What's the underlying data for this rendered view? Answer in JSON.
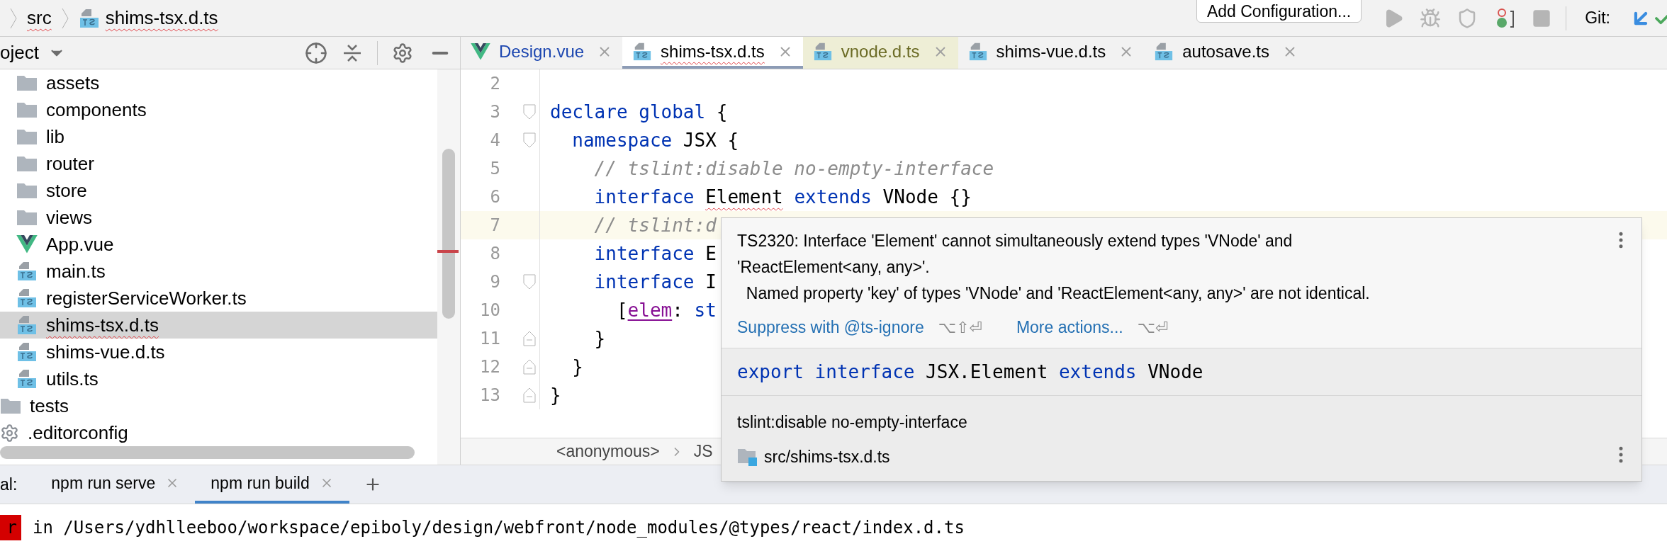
{
  "breadcrumb": [
    {
      "label": "src",
      "kind": "folder",
      "error": true
    },
    {
      "label": "shims-tsx.d.ts",
      "kind": "ts",
      "error": true
    }
  ],
  "toolbar": {
    "run_config": "Add Configuration...",
    "git_label": "Git:"
  },
  "project_panel": {
    "title": "oject"
  },
  "tree": [
    {
      "children": [
        {
          "label": "assets",
          "kind": "folder",
          "selected": false,
          "error": false
        },
        {
          "label": "components",
          "kind": "folder",
          "selected": false,
          "error": false
        },
        {
          "label": "lib",
          "kind": "folder",
          "selected": false,
          "error": false
        },
        {
          "label": "router",
          "kind": "folder",
          "selected": false,
          "error": false
        },
        {
          "label": "store",
          "kind": "folder",
          "selected": false,
          "error": false
        },
        {
          "label": "views",
          "kind": "folder",
          "selected": false,
          "error": false
        },
        {
          "label": "App.vue",
          "kind": "vue",
          "selected": false,
          "error": false
        },
        {
          "label": "main.ts",
          "kind": "ts",
          "selected": false,
          "error": false
        },
        {
          "label": "registerServiceWorker.ts",
          "kind": "ts",
          "selected": false,
          "error": false
        },
        {
          "label": "shims-tsx.d.ts",
          "kind": "ts",
          "selected": true,
          "error": true
        },
        {
          "label": "shims-vue.d.ts",
          "kind": "ts",
          "selected": false,
          "error": false
        },
        {
          "label": "utils.ts",
          "kind": "ts",
          "selected": false,
          "error": false
        }
      ]
    },
    {
      "label": "tests",
      "kind": "folder",
      "selected": false,
      "error": false
    },
    {
      "label": ".editorconfig",
      "kind": "config",
      "selected": false,
      "error": false
    }
  ],
  "editor_tabs": [
    {
      "label": "Design.vue",
      "kind": "vue",
      "modified": true,
      "library": false,
      "selected": false,
      "error": false
    },
    {
      "label": "shims-tsx.d.ts",
      "kind": "ts",
      "modified": false,
      "library": false,
      "selected": true,
      "error": true
    },
    {
      "label": "vnode.d.ts",
      "kind": "ts",
      "modified": false,
      "library": true,
      "selected": false,
      "error": false
    },
    {
      "label": "shims-vue.d.ts",
      "kind": "ts",
      "modified": false,
      "library": false,
      "selected": false,
      "error": false
    },
    {
      "label": "autosave.ts",
      "kind": "ts",
      "modified": false,
      "library": false,
      "selected": false,
      "error": false
    }
  ],
  "code_lines": [
    {
      "number": "2",
      "current": false,
      "fold_start": false,
      "fold_end": false
    },
    {
      "number": "3",
      "current": false,
      "fold_start": true,
      "fold_end": false,
      "tokens": [
        {
          "text": "declare global",
          "kind": "keyword"
        },
        {
          "text": " {",
          "kind": "plain"
        }
      ]
    },
    {
      "number": "4",
      "current": false,
      "fold_start": true,
      "fold_end": false,
      "tokens": [
        {
          "text": "  namespace",
          "kind": "keyword"
        },
        {
          "text": " JSX {",
          "kind": "plain"
        }
      ]
    },
    {
      "number": "5",
      "current": false,
      "fold_start": false,
      "fold_end": false,
      "tokens": [
        {
          "text": "    // tslint:disable no-empty-interface",
          "kind": "comment"
        }
      ]
    },
    {
      "number": "6",
      "current": false,
      "fold_start": false,
      "fold_end": false,
      "tokens": [
        {
          "text": "    interface ",
          "kind": "keyword"
        },
        {
          "text": "Element",
          "kind": "error"
        },
        {
          "text": " extends",
          "kind": "keyword"
        },
        {
          "text": " VNode {}",
          "kind": "plain"
        }
      ]
    },
    {
      "number": "7",
      "current": true,
      "fold_start": false,
      "fold_end": false,
      "tokens": [
        {
          "text": "    // tslint:d",
          "kind": "comment"
        }
      ]
    },
    {
      "number": "8",
      "current": false,
      "fold_start": false,
      "fold_end": false,
      "tokens": [
        {
          "text": "    interface",
          "kind": "keyword"
        },
        {
          "text": " E",
          "kind": "plain"
        }
      ]
    },
    {
      "number": "9",
      "current": false,
      "fold_start": true,
      "fold_end": false,
      "tokens": [
        {
          "text": "    interface",
          "kind": "keyword"
        },
        {
          "text": " I",
          "kind": "plain"
        }
      ]
    },
    {
      "number": "10",
      "current": false,
      "fold_start": false,
      "fold_end": false,
      "tokens": [
        {
          "text": "      [",
          "kind": "plain"
        },
        {
          "text": "elem",
          "kind": "property"
        },
        {
          "text": ": ",
          "kind": "plain"
        },
        {
          "text": "st",
          "kind": "keyword"
        }
      ]
    },
    {
      "number": "11",
      "current": false,
      "fold_start": false,
      "fold_end": true,
      "tokens": [
        {
          "text": "    }",
          "kind": "plain"
        }
      ]
    },
    {
      "number": "12",
      "current": false,
      "fold_start": false,
      "fold_end": true,
      "tokens": [
        {
          "text": "  }",
          "kind": "plain"
        }
      ]
    },
    {
      "number": "13",
      "current": false,
      "fold_start": false,
      "fold_end": true,
      "tokens": [
        {
          "text": "}",
          "kind": "plain"
        }
      ]
    }
  ],
  "editor_breadcrumb": [
    "<anonymous>",
    "JS"
  ],
  "popup": {
    "message": [
      "TS2320: Interface 'Element' cannot simultaneously extend types 'VNode' and",
      "'ReactElement<any, any>'.",
      "  Named property 'key' of types 'VNode' and 'ReactElement<any, any>' are not identical."
    ],
    "actions": [
      {
        "label": "Suppress with @ts-ignore",
        "shortcut": "⌥⇧⏎"
      },
      {
        "label": "More actions...",
        "shortcut": "⌥⏎"
      }
    ],
    "signature": [
      {
        "text": "export interface",
        "kind": "keyword"
      },
      {
        "text": " JSX.Element ",
        "kind": "plain"
      },
      {
        "text": "extends",
        "kind": "keyword"
      },
      {
        "text": " VNode",
        "kind": "plain"
      }
    ],
    "doc": "tslint:disable no-empty-interface",
    "location": "src/shims-tsx.d.ts"
  },
  "terminal": {
    "label": "al:",
    "tabs": [
      {
        "label": "npm run serve",
        "selected": false
      },
      {
        "label": "npm run build",
        "selected": true
      }
    ]
  },
  "output": {
    "badge": "r",
    "text": "in /Users/ydhlleeboo/workspace/epiboly/design/webfront/node_modules/@types/react/index.d.ts"
  }
}
